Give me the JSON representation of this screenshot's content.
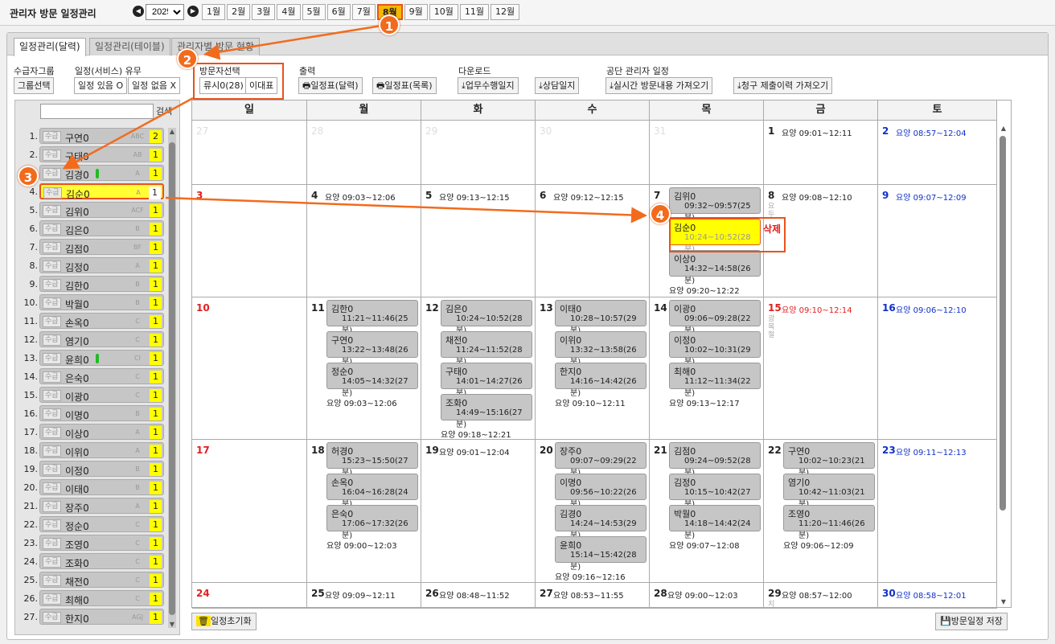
{
  "app": {
    "title": "관리자 방문 일정관리"
  },
  "year": "2025",
  "months": [
    "1월",
    "2월",
    "3월",
    "4월",
    "5월",
    "6월",
    "7월",
    "8월",
    "9월",
    "10월",
    "11월",
    "12월"
  ],
  "active_month": "8월",
  "tabs": [
    "일정관리(달력)",
    "일정관리(테이블)",
    "관리자별 방문 현황"
  ],
  "controls": {
    "group_label": "수급자그룹",
    "group_btn": "그룹선택",
    "service_label": "일정(서비스) 유무",
    "svc_yes": "일정 있음 O",
    "svc_no": "일정 없음 X",
    "visitor_label": "방문자선택",
    "visitor_btn": "류시0(28)",
    "rep_btn": "이대표",
    "print_label": "출력",
    "print_cal": "일정표(달력)",
    "print_list": "일정표(목록)",
    "download_label": "다운로드",
    "dl_work": "업무수행일지",
    "dl_consult": "상담일지",
    "public_label": "공단 관리자 일정",
    "pub_realtime": "실시간 방문내용 가져오기",
    "pub_claim": "청구 제출이력 가져오기"
  },
  "sidebar": {
    "search_label": "검색",
    "tag": "수급",
    "clients": [
      {
        "num": "1.",
        "name": "구연0",
        "code": "ABC",
        "cnt": "2"
      },
      {
        "num": "2.",
        "name": "구태0",
        "code": "AB",
        "cnt": "1"
      },
      {
        "num": "3.",
        "name": "김경0",
        "code": "A",
        "cnt": "1",
        "green": true
      },
      {
        "num": "4.",
        "name": "김순0",
        "code": "A",
        "cnt": "1",
        "hl": true
      },
      {
        "num": "5.",
        "name": "김위0",
        "code": "ACF",
        "cnt": "1"
      },
      {
        "num": "6.",
        "name": "김은0",
        "code": "B",
        "cnt": "1"
      },
      {
        "num": "7.",
        "name": "김점0",
        "code": "BF",
        "cnt": "1"
      },
      {
        "num": "8.",
        "name": "김정0",
        "code": "A",
        "cnt": "1"
      },
      {
        "num": "9.",
        "name": "김한0",
        "code": "B",
        "cnt": "1"
      },
      {
        "num": "10.",
        "name": "박월0",
        "code": "B",
        "cnt": "1"
      },
      {
        "num": "11.",
        "name": "손옥0",
        "code": "C",
        "cnt": "1"
      },
      {
        "num": "12.",
        "name": "염기0",
        "code": "C",
        "cnt": "1"
      },
      {
        "num": "13.",
        "name": "윤희0",
        "code": "CI",
        "cnt": "1",
        "green": true
      },
      {
        "num": "14.",
        "name": "은숙0",
        "code": "C",
        "cnt": "1"
      },
      {
        "num": "15.",
        "name": "이광0",
        "code": "C",
        "cnt": "1"
      },
      {
        "num": "16.",
        "name": "이명0",
        "code": "B",
        "cnt": "1"
      },
      {
        "num": "17.",
        "name": "이상0",
        "code": "A",
        "cnt": "1"
      },
      {
        "num": "18.",
        "name": "이위0",
        "code": "A",
        "cnt": "1"
      },
      {
        "num": "19.",
        "name": "이정0",
        "code": "B",
        "cnt": "1"
      },
      {
        "num": "20.",
        "name": "이태0",
        "code": "B",
        "cnt": "1"
      },
      {
        "num": "21.",
        "name": "장주0",
        "code": "A",
        "cnt": "1"
      },
      {
        "num": "22.",
        "name": "정순0",
        "code": "C",
        "cnt": "1"
      },
      {
        "num": "23.",
        "name": "조영0",
        "code": "C",
        "cnt": "1"
      },
      {
        "num": "24.",
        "name": "조화0",
        "code": "C",
        "cnt": "1"
      },
      {
        "num": "25.",
        "name": "채전0",
        "code": "C",
        "cnt": "1"
      },
      {
        "num": "26.",
        "name": "최해0",
        "code": "C",
        "cnt": "1"
      },
      {
        "num": "27.",
        "name": "한지0",
        "code": "AGJ",
        "cnt": "1"
      }
    ]
  },
  "calendar": {
    "weekdays": [
      "일",
      "월",
      "화",
      "수",
      "목",
      "금",
      "토"
    ],
    "delete_label": "삭제",
    "weeks": [
      [
        {
          "d": "27",
          "other": true
        },
        {
          "d": "28",
          "other": true
        },
        {
          "d": "29",
          "other": true
        },
        {
          "d": "30",
          "other": true
        },
        {
          "d": "31",
          "other": true
        },
        {
          "d": "1",
          "y": "요양 09:01~12:11"
        },
        {
          "d": "2",
          "y": "요양 08:57~12:04",
          "sat": true
        }
      ],
      [
        {
          "d": "3",
          "sun": true
        },
        {
          "d": "4",
          "y": "요양 09:03~12:06"
        },
        {
          "d": "5",
          "y": "요양 09:13~12:15"
        },
        {
          "d": "6",
          "y": "요양 09:12~12:15"
        },
        {
          "d": "7",
          "evts": [
            [
              "김위0",
              "09:32~09:57(25분)"
            ],
            [
              "김순0",
              "10:24~10:52(28분)",
              true
            ],
            [
              "이상0",
              "14:32~14:58(26분)"
            ]
          ],
          "yb": "요양 09:20~12:22"
        },
        {
          "d": "8",
          "y": "요양 09:08~12:10",
          "v": "요두"
        },
        {
          "d": "9",
          "y": "요양 09:07~12:09",
          "sat": true
        }
      ],
      [
        {
          "d": "10",
          "sun": true
        },
        {
          "d": "11",
          "evts": [
            [
              "김한0",
              "11:21~11:46(25분)"
            ],
            [
              "구연0",
              "13:22~13:48(26분)"
            ],
            [
              "정순0",
              "14:05~14:32(27분)"
            ]
          ],
          "yb": "요양 09:03~12:06"
        },
        {
          "d": "12",
          "evts": [
            [
              "김은0",
              "10:24~10:52(28분)"
            ],
            [
              "채전0",
              "11:24~11:52(28분)"
            ],
            [
              "구태0",
              "14:01~14:27(26분)"
            ],
            [
              "조화0",
              "14:49~15:16(27분)"
            ]
          ],
          "yb": "요양 09:18~12:21"
        },
        {
          "d": "13",
          "evts": [
            [
              "이태0",
              "10:28~10:57(29분)"
            ],
            [
              "이위0",
              "13:32~13:58(26분)"
            ],
            [
              "한지0",
              "14:16~14:42(26분)"
            ]
          ],
          "yb": "요양 09:10~12:11"
        },
        {
          "d": "14",
          "evts": [
            [
              "이광0",
              "09:06~09:28(22분)"
            ],
            [
              "이정0",
              "10:02~10:31(29분)"
            ],
            [
              "최해0",
              "11:12~11:34(22분)"
            ]
          ],
          "yb": "요양 09:13~12:17"
        },
        {
          "d": "15",
          "y": "요양 09:10~12:14",
          "sun": true,
          "v": "광복절"
        },
        {
          "d": "16",
          "y": "요양 09:06~12:10",
          "sat": true
        }
      ],
      [
        {
          "d": "17",
          "sun": true
        },
        {
          "d": "18",
          "evts": [
            [
              "허경0",
              "15:23~15:50(27분)"
            ],
            [
              "손옥0",
              "16:04~16:28(24분)"
            ],
            [
              "은숙0",
              "17:06~17:32(26분)"
            ]
          ],
          "yb": "요양 09:00~12:03"
        },
        {
          "d": "19",
          "y": "요양 09:01~12:04"
        },
        {
          "d": "20",
          "evts": [
            [
              "장주0",
              "09:07~09:29(22분)"
            ],
            [
              "이명0",
              "09:56~10:22(26분)"
            ],
            [
              "김경0",
              "14:24~14:53(29분)"
            ],
            [
              "윤희0",
              "15:14~15:42(28분)"
            ]
          ],
          "yb": "요양 09:16~12:16"
        },
        {
          "d": "21",
          "evts": [
            [
              "김점0",
              "09:24~09:52(28분)"
            ],
            [
              "김정0",
              "10:15~10:42(27분)"
            ],
            [
              "박월0",
              "14:18~14:42(24분)"
            ]
          ],
          "yb": "요양 09:07~12:08"
        },
        {
          "d": "22",
          "evts": [
            [
              "구연0",
              "10:02~10:23(21분)"
            ],
            [
              "염기0",
              "10:42~11:03(21분)"
            ],
            [
              "조영0",
              "11:20~11:46(26분)"
            ]
          ],
          "yb": "요양 09:06~12:09"
        },
        {
          "d": "23",
          "y": "요양 09:11~12:13",
          "sat": true
        }
      ],
      [
        {
          "d": "24",
          "sun": true
        },
        {
          "d": "25",
          "y": "요양 09:09~12:11"
        },
        {
          "d": "26",
          "y": "요양 08:48~11:52"
        },
        {
          "d": "27",
          "y": "요양 08:53~11:55"
        },
        {
          "d": "28",
          "y": "요양 09:00~12:03"
        },
        {
          "d": "29",
          "y": "요양 08:57~12:00",
          "v": "치밀"
        },
        {
          "d": "30",
          "y": "요양 08:58~12:01",
          "sat": true
        }
      ]
    ]
  },
  "bottom": {
    "reset": "일정초기화",
    "save": "방문일정 저장"
  },
  "markers": [
    "1",
    "2",
    "3",
    "4"
  ],
  "colors": {
    "highlight": "#ffff00",
    "accent": "#e8531c",
    "month_active": "#f5b800",
    "sunday": "#e02020",
    "saturday": "#1030c8"
  }
}
